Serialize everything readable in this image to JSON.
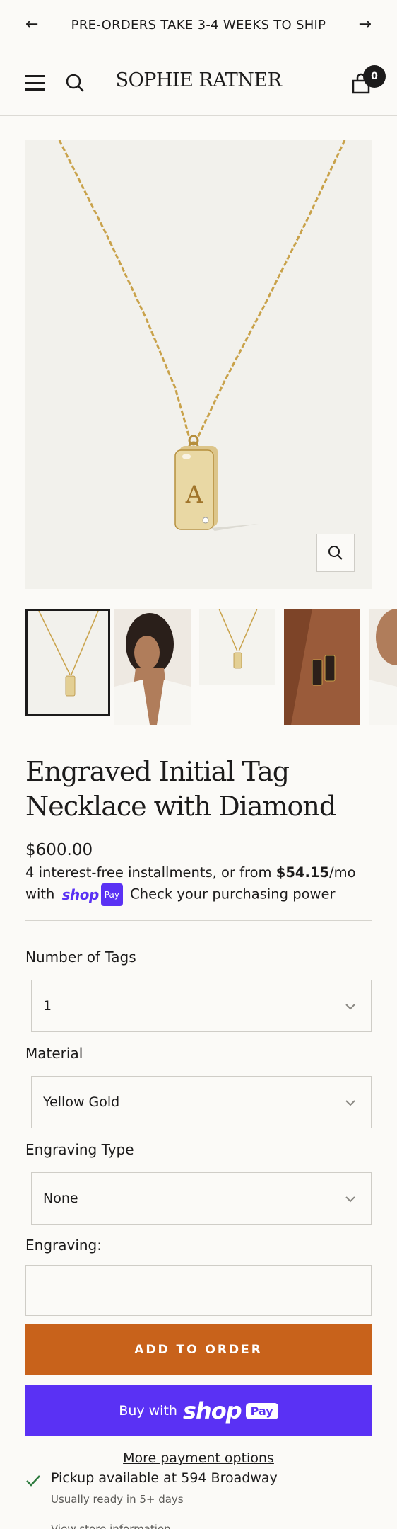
{
  "announcement": {
    "prev_icon": "arrow-left-icon",
    "text": "PRE-ORDERS TAKE 3-4 WEEKS TO SHIP",
    "next_icon": "arrow-right-icon"
  },
  "header": {
    "menu_icon": "hamburger-menu-icon",
    "search_icon": "search-icon",
    "logo": "SOPHIE RATNER",
    "cart_icon": "shopping-bag-icon",
    "cart_count": "0"
  },
  "gallery": {
    "zoom_icon": "magnifier-icon",
    "thumbnails": [
      "necklace-product",
      "model-profile",
      "necklace-product-small",
      "two-tags-on-model",
      "model-smiling"
    ]
  },
  "product": {
    "title": "Engraved Initial Tag Necklace with Diamond",
    "price": "$600.00",
    "installments_text": "4 interest-free installments, or from",
    "installment_amount": "$54.15",
    "installment_period": "/mo",
    "with_text": "with",
    "shop_text": "shop",
    "pay_text": "Pay",
    "purchasing_power": "Check your purchasing power"
  },
  "options": {
    "tags_label": "Number of Tags",
    "tags_value": "1",
    "material_label": "Material",
    "material_value": "Yellow Gold",
    "engraving_type_label": "Engraving Type",
    "engraving_type_value": "None",
    "engraving_label": "Engraving:",
    "engraving_value": ""
  },
  "actions": {
    "add_to_order": "ADD TO ORDER",
    "buy_with": "Buy with",
    "buy_shop": "shop",
    "buy_pay": "Pay",
    "more_payment": "More payment options"
  },
  "pickup": {
    "title": "Pickup available at 594 Broadway",
    "note": "Usually ready in 5+ days",
    "info_link": "View store information"
  },
  "colors": {
    "accent_orange": "#c8621b",
    "shop_pay_purple": "#5a31f4",
    "background": "#fbfaf7",
    "gold": "#c9a24a"
  }
}
